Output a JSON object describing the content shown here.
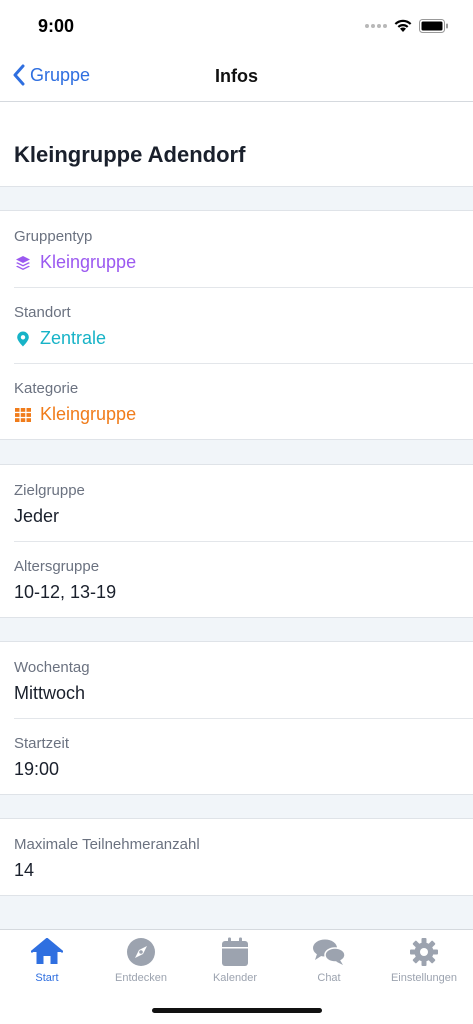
{
  "status": {
    "time": "9:00"
  },
  "nav": {
    "back_label": "Gruppe",
    "title": "Infos"
  },
  "group": {
    "title": "Kleingruppe Adendorf"
  },
  "sections": [
    [
      {
        "label": "Gruppentyp",
        "value": "Kleingruppe",
        "icon": "layers-icon",
        "color": "#9b59f0"
      },
      {
        "label": "Standort",
        "value": "Zentrale",
        "icon": "map-pin-icon",
        "color": "#17b3c7"
      },
      {
        "label": "Kategorie",
        "value": "Kleingruppe",
        "icon": "grid-icon",
        "color": "#f07c1b"
      }
    ],
    [
      {
        "label": "Zielgruppe",
        "value": "Jeder"
      },
      {
        "label": "Altersgruppe",
        "value": "10-12, 13-19"
      }
    ],
    [
      {
        "label": "Wochentag",
        "value": "Mittwoch"
      },
      {
        "label": "Startzeit",
        "value": "19:00"
      }
    ],
    [
      {
        "label": "Maximale Teilnehmeranzahl",
        "value": "14"
      }
    ]
  ],
  "tabs": [
    {
      "label": "Start",
      "icon": "home-icon",
      "active": true
    },
    {
      "label": "Entdecken",
      "icon": "compass-icon"
    },
    {
      "label": "Kalender",
      "icon": "calendar-icon"
    },
    {
      "label": "Chat",
      "icon": "chat-icon"
    },
    {
      "label": "Einstellungen",
      "icon": "gear-icon"
    }
  ],
  "colors": {
    "accent": "#2f6fe0",
    "tab_inactive": "#9ca3af"
  }
}
